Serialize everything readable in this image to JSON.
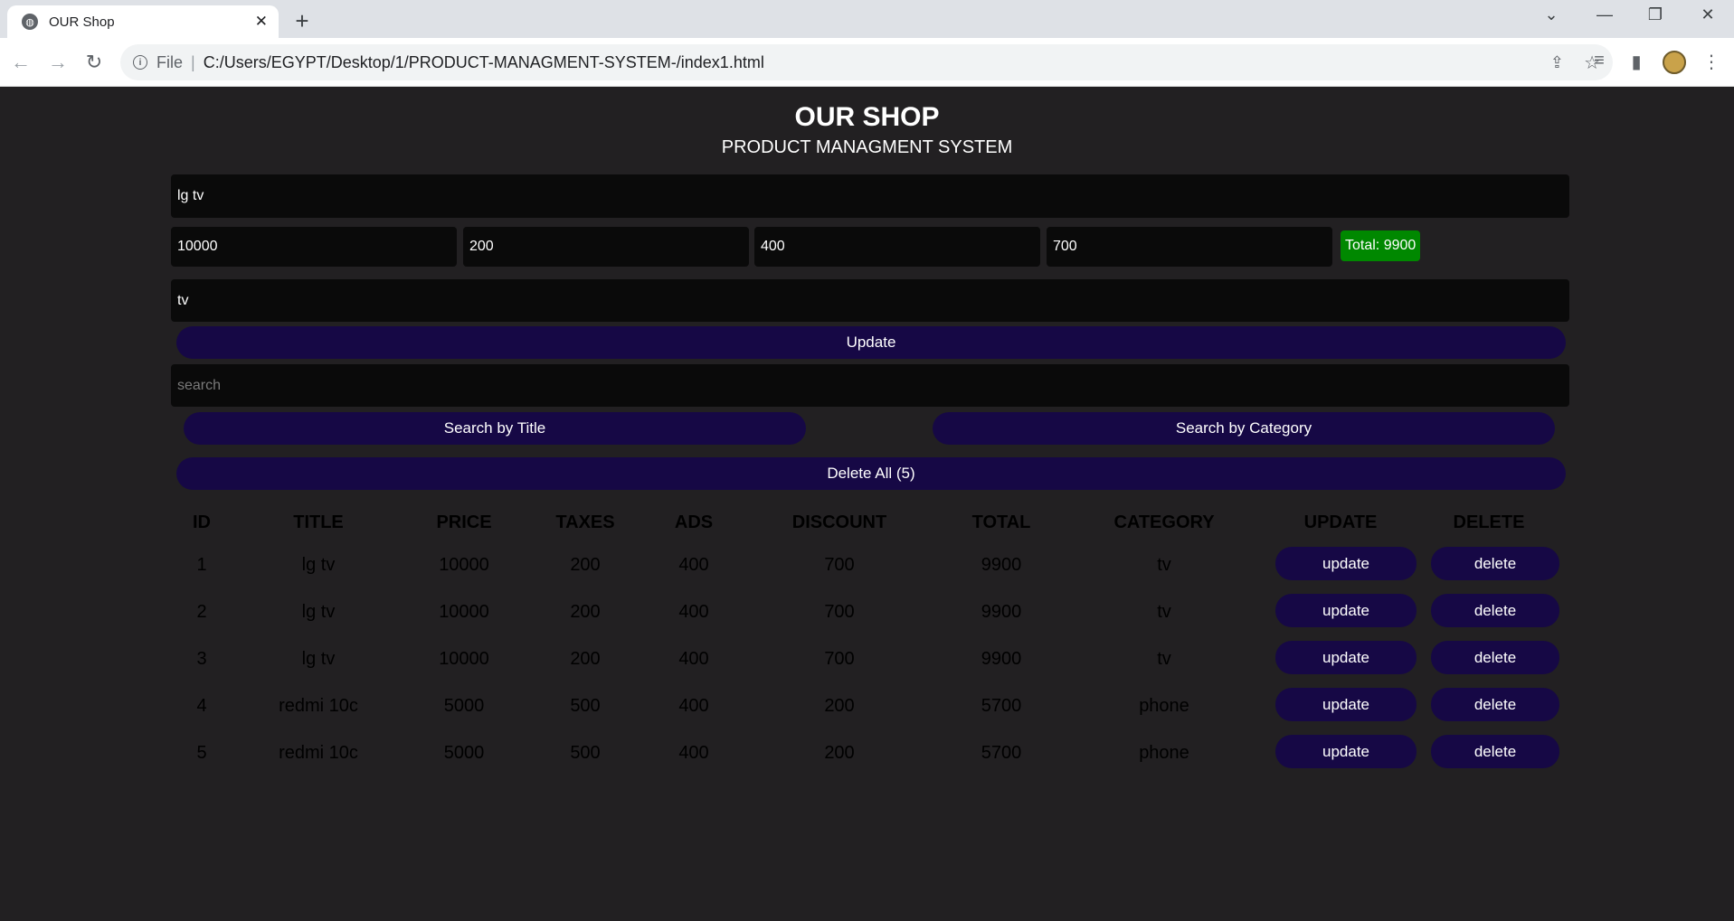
{
  "browser": {
    "tab_title": "OUR Shop",
    "address_scheme": "File",
    "address_url": "C:/Users/EGYPT/Desktop/1/PRODUCT-MANAGMENT-SYSTEM-/index1.html"
  },
  "header": {
    "title": "OUR SHOP",
    "subtitle": "PRODUCT MANAGMENT SYSTEM"
  },
  "form": {
    "title_value": "lg tv",
    "price_value": "10000",
    "taxes_value": "200",
    "ads_value": "400",
    "discount_value": "700",
    "total_label": "Total: 9900",
    "category_value": "tv",
    "submit_label": "Update"
  },
  "search": {
    "placeholder": "search",
    "by_title_label": "Search by Title",
    "by_category_label": "Search by Category"
  },
  "delete_all_label": "Delete All (5)",
  "table": {
    "headers": [
      "ID",
      "TITLE",
      "PRICE",
      "TAXES",
      "ADS",
      "DISCOUNT",
      "TOTAL",
      "CATEGORY",
      "UPDATE",
      "DELETE"
    ],
    "rows": [
      {
        "id": "1",
        "title": "lg tv",
        "price": "10000",
        "taxes": "200",
        "ads": "400",
        "discount": "700",
        "total": "9900",
        "category": "tv",
        "update": "update",
        "delete": "delete"
      },
      {
        "id": "2",
        "title": "lg tv",
        "price": "10000",
        "taxes": "200",
        "ads": "400",
        "discount": "700",
        "total": "9900",
        "category": "tv",
        "update": "update",
        "delete": "delete"
      },
      {
        "id": "3",
        "title": "lg tv",
        "price": "10000",
        "taxes": "200",
        "ads": "400",
        "discount": "700",
        "total": "9900",
        "category": "tv",
        "update": "update",
        "delete": "delete"
      },
      {
        "id": "4",
        "title": "redmi 10c",
        "price": "5000",
        "taxes": "500",
        "ads": "400",
        "discount": "200",
        "total": "5700",
        "category": "phone",
        "update": "update",
        "delete": "delete"
      },
      {
        "id": "5",
        "title": "redmi 10c",
        "price": "5000",
        "taxes": "500",
        "ads": "400",
        "discount": "200",
        "total": "5700",
        "category": "phone",
        "update": "update",
        "delete": "delete"
      }
    ]
  },
  "colors": {
    "background": "#222022",
    "field": "#0a0a0a",
    "button": "#160845",
    "total_ok": "#008800"
  }
}
